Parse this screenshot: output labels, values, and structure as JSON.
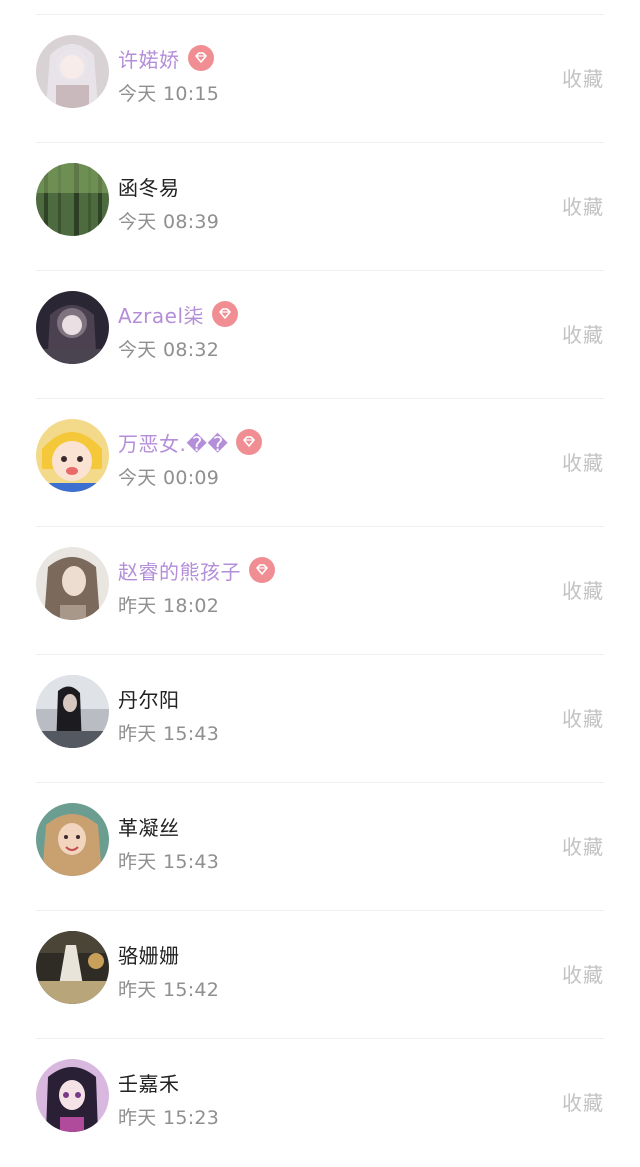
{
  "favorite_label": "收藏",
  "badge_icon": "vip-diamond-icon",
  "colors": {
    "vip_name": "#b48ed8",
    "normal_name": "#222222",
    "time": "#8f8f8f",
    "favorite": "#c2c2c2",
    "badge": "#f08e93"
  },
  "users": [
    {
      "name": "许婼娇",
      "time": "今天 10:15",
      "vip": true
    },
    {
      "name": "函冬易",
      "time": "今天 08:39",
      "vip": false
    },
    {
      "name": "Azrael柒",
      "time": "今天 08:32",
      "vip": true
    },
    {
      "name": "万恶女.��",
      "time": "今天 00:09",
      "vip": true
    },
    {
      "name": "赵睿的熊孩子",
      "time": "昨天 18:02",
      "vip": true
    },
    {
      "name": "丹尔阳",
      "time": "昨天 15:43",
      "vip": false
    },
    {
      "name": "革凝丝",
      "time": "昨天 15:43",
      "vip": false
    },
    {
      "name": "骆姗姗",
      "time": "昨天 15:42",
      "vip": false
    },
    {
      "name": "壬嘉禾",
      "time": "昨天 15:23",
      "vip": false
    }
  ]
}
